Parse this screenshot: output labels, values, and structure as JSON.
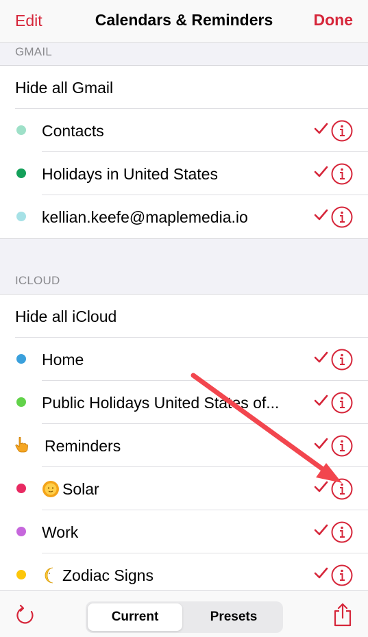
{
  "navbar": {
    "edit_label": "Edit",
    "title": "Calendars & Reminders",
    "done_label": "Done"
  },
  "sections": {
    "gmail": {
      "header": "GMAIL",
      "hide_all_label": "Hide all Gmail",
      "items": [
        {
          "label": "Contacts",
          "dot_color": "#9ee0c8"
        },
        {
          "label": "Holidays in United States",
          "dot_color": "#14a05a"
        },
        {
          "label": "kellian.keefe@maplemedia.io",
          "dot_color": "#a6e1e6"
        }
      ]
    },
    "icloud": {
      "header": "ICLOUD",
      "hide_all_label": "Hide all iCloud",
      "items": [
        {
          "label": "Home",
          "dot_color": "#3aa0dc"
        },
        {
          "label": "Public Holidays United States of...",
          "dot_color": "#62d24a"
        },
        {
          "label": "Reminders",
          "icon": "pointing-hand-icon"
        },
        {
          "label": "Solar",
          "dot_color": "#e82a62",
          "emoji": "sun-face-icon"
        },
        {
          "label": "Work",
          "dot_color": "#c667dc"
        },
        {
          "label": "Zodiac Signs",
          "dot_color": "#fcc60a",
          "emoji": "crescent-moon-icon"
        }
      ]
    }
  },
  "toolbar": {
    "segments": [
      {
        "label": "Current",
        "selected": true
      },
      {
        "label": "Presets",
        "selected": false
      }
    ],
    "refresh_icon": "refresh-icon",
    "share_icon": "share-icon"
  },
  "colors": {
    "accent": "#d6263a",
    "annotation_arrow": "#f2464e"
  }
}
